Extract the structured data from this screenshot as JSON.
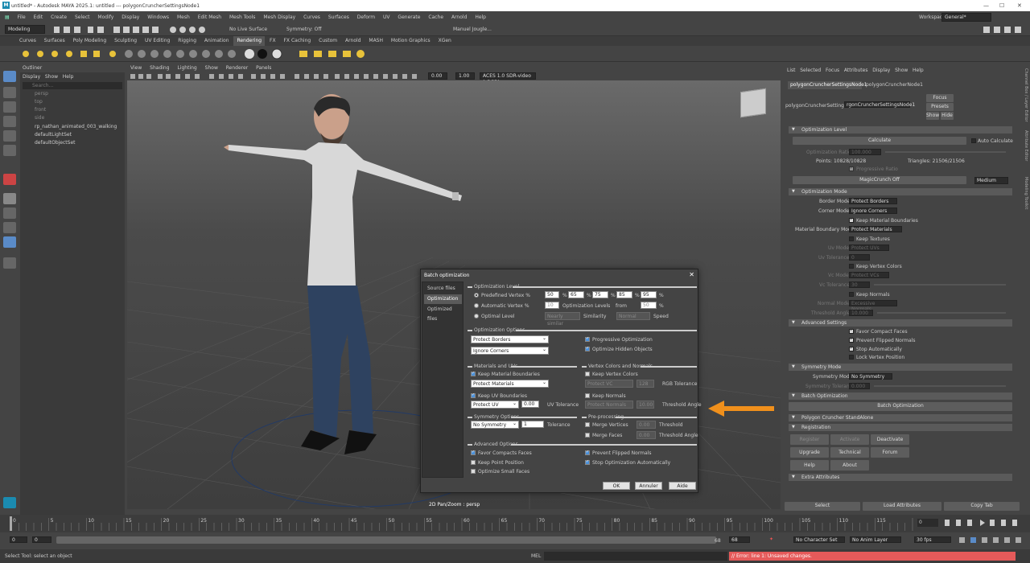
{
  "window": {
    "title": "untitled* - Autodesk MAYA 2025.1: untitled  ---  polygonCruncherSettingsNode1"
  },
  "menubar": [
    "File",
    "Edit",
    "Create",
    "Select",
    "Modify",
    "Display",
    "Windows",
    "Mesh",
    "Edit Mesh",
    "Mesh Tools",
    "Mesh Display",
    "Curves",
    "Surfaces",
    "Deform",
    "UV",
    "Generate",
    "Cache",
    "Arnold",
    "Help"
  ],
  "workspace": {
    "label": "Workspace :",
    "value": "General*"
  },
  "statusline": {
    "mode": "Modeling",
    "live": "No Live Surface",
    "symmetry": "Symmetry: Off",
    "user": "Manuel Jougle..."
  },
  "shelf_tabs": [
    "Curves",
    "Surfaces",
    "Poly Modeling",
    "Sculpting",
    "UV Editing",
    "Rigging",
    "Animation",
    "Rendering",
    "FX",
    "FX Caching",
    "Custom",
    "Arnold",
    "MASH",
    "Motion Graphics",
    "XGen"
  ],
  "shelf_active": "Rendering",
  "outliner": {
    "title": "Outliner",
    "menu": [
      "Display",
      "Show",
      "Help"
    ],
    "search": "Search...",
    "items": [
      "persp",
      "top",
      "front",
      "side",
      "rp_nathan_animated_003_walking",
      "defaultLightSet",
      "defaultObjectSet"
    ]
  },
  "viewport": {
    "menu": [
      "View",
      "Shading",
      "Lighting",
      "Show",
      "Renderer",
      "Panels"
    ],
    "exposure": "0.00",
    "gamma": "1.00",
    "colorspace": "ACES 1.0 SDR-video (sRGB)",
    "caption": "2D Pan/Zoom : persp"
  },
  "ae": {
    "menu": [
      "List",
      "Selected",
      "Focus",
      "Attributes",
      "Display",
      "Show",
      "Help"
    ],
    "tabs": [
      "polygonCruncherSettingsNode1",
      "polygonCruncherNode1"
    ],
    "node_label": "polygonCruncherSettingsNc",
    "node_value": "rgonCruncherSettingsNode1",
    "focus": "Focus",
    "presets": "Presets",
    "show": "Show",
    "hide": "Hide",
    "sec_opt_level": "Optimization Level",
    "calculate": "Calculate",
    "auto_calculate": "Auto Calculate",
    "ratio_label": "Optimization Ratio",
    "ratio_value": "100.000",
    "points": "Points: 10828/10828",
    "triangles": "Triangles: 21506/21506",
    "progressive_ratio": "Progressive Ratio",
    "magic": "MagicCrunch Off",
    "magic_quality": "Medium",
    "sec_opt_mode": "Optimization Mode",
    "border_mode_label": "Border Mode",
    "border_mode": "Protect Borders",
    "corner_mode_label": "Corner Mode",
    "corner_mode": "Ignore Corners",
    "keep_mat": "Keep Material Boundaries",
    "mat_mode_label": "Material Boundary Mode",
    "mat_mode": "Protect Materials",
    "keep_tex": "Keep Textures",
    "uv_mode_label": "Uv Mode",
    "uv_mode": "Protect UVs",
    "uv_tol_label": "Uv Tolerance",
    "uv_tol": "0",
    "keep_vc": "Keep Vertex Colors",
    "vc_mode_label": "Vc Mode",
    "vc_mode": "Protect VCs",
    "vc_tol_label": "Vc Tolerance",
    "vc_tol": "30",
    "keep_normals": "Keep Normals",
    "normal_mode_label": "Normal Mode",
    "normal_mode": "Excessive Normals",
    "threshold_label": "Threshold Angle",
    "threshold": "10.000",
    "sec_adv": "Advanced Settings",
    "adv": [
      "Favor Compact Faces",
      "Prevent Flipped Normals",
      "Stop Automatically",
      "Lock Vertex Position"
    ],
    "sec_sym": "Symmetry Mode",
    "sym_label": "Symmetry Mode",
    "sym_value": "No Symmetry",
    "sym_tol_label": "Symmetry Tolerance",
    "sym_tol": "0.000",
    "sec_batch": "Batch Optimization",
    "batch_button": "Batch Optimization",
    "sec_standalone": "Polygon Cruncher StandAlone",
    "sec_reg": "Registration",
    "register": "Register",
    "activate": "Activate",
    "deactivate": "Deactivate",
    "upgrade": "Upgrade",
    "tech": "Technical Support",
    "forum": "Forum",
    "help": "Help",
    "about": "About",
    "sec_extra": "Extra Attributes",
    "bottom": [
      "Select",
      "Load Attributes",
      "Copy Tab"
    ],
    "side_tabs": [
      "Channel Box / Layer Editor",
      "Attribute Editor",
      "Modeling Toolkit"
    ]
  },
  "dialog": {
    "title": "Batch optimization",
    "nav": [
      "Source files",
      "Optimization",
      "Optimized files"
    ],
    "opt_level": "Optimization Level",
    "predefined": "Predefined Vertex %",
    "pv": [
      "50",
      "65",
      "75",
      "85",
      "95"
    ],
    "pct": "%",
    "automatic": "Automatic Vertex %",
    "auto_val": "10",
    "opt_levels": "Optimization Levels",
    "from": "from",
    "from_val": "50",
    "optimal": "Optimal Level",
    "nearly": "Nearly similar",
    "similarity": "Similarity",
    "normal": "Normal",
    "speed": "Speed",
    "opt_options": "Optimization Options",
    "protect_borders": "Protect Borders",
    "ignore_corners": "Ignore Corners",
    "progressive": "Progressive Optimization",
    "optimize_hidden": "Optimize Hidden Objects",
    "mat_uv": "Materials and UVs",
    "keep_mat": "Keep Material Boundaries",
    "protect_materials": "Protect Materials",
    "keep_uv": "Keep UV Boundaries",
    "protect_uv": "Protect UV",
    "uv_tol_val": "0.00",
    "uv_tol": "UV Tolerance",
    "vc_normals": "Vertex Colors and Normals",
    "keep_vc": "Keep Vertex Colors",
    "protect_vc": "Protect VC",
    "rgb_val": "128",
    "rgb_tol": "RGB Tolerance",
    "keep_normals": "Keep Normals",
    "protect_normals": "Protect Normals",
    "thr_val": "10.00",
    "thr": "Threshold Angle",
    "sym_options": "Symmetry Options",
    "no_symmetry": "No Symmetry",
    "tol_val": "1",
    "tolerance": "Tolerance",
    "preproc": "Pre-processing",
    "merge_vertices": "Merge Vertices",
    "mv_val": "0.00",
    "mv_thr": "Threshold",
    "merge_faces": "Merge Faces",
    "mf_val": "0.00",
    "mf_thr": "Threshold Angle",
    "adv_options": "Advanced Options",
    "favor": "Favor Compacts Faces",
    "keep_point": "Keep Point Position",
    "optimize_small": "Optimize Small Faces",
    "prevent": "Prevent Flipped Normals",
    "stop_auto": "Stop Optimization Automatically",
    "ok": "OK",
    "cancel": "Annuler",
    "help": "Aide"
  },
  "timeline": {
    "ticks": [
      "0",
      "5",
      "10",
      "15",
      "20",
      "25",
      "30",
      "35",
      "40",
      "45",
      "50",
      "55",
      "60",
      "65",
      "70",
      "75",
      "80",
      "85",
      "90",
      "95",
      "100",
      "105",
      "110",
      "115",
      "120"
    ],
    "current": "0"
  },
  "range": {
    "start": "0",
    "start2": "0",
    "end_a": "68",
    "end_b": "68",
    "char_set": "No Character Set",
    "anim_layer": "No Anim Layer",
    "fps": "30 fps"
  },
  "cmdline": {
    "help": "Select Tool: select an object",
    "mel": "MEL",
    "error": "// Error: line 1: Unsaved changes."
  }
}
